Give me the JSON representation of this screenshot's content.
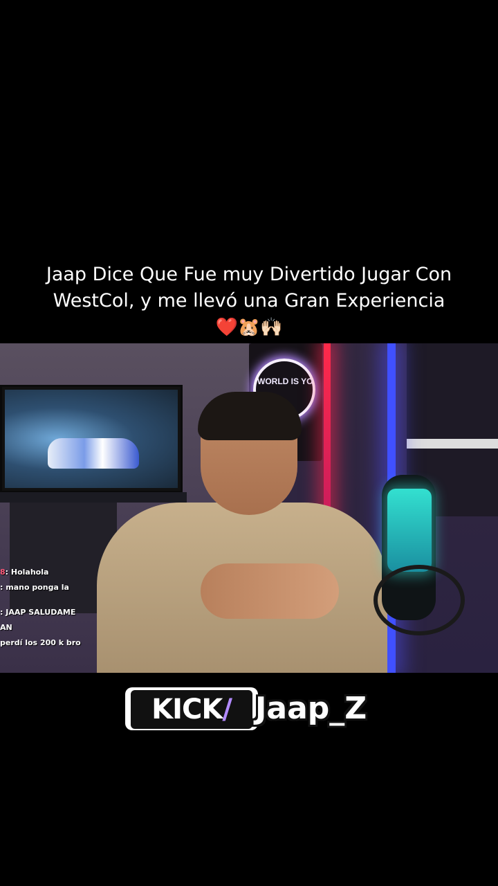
{
  "caption": {
    "line1": "Jaap Dice Que Fue muy Divertido Jugar Con",
    "line2": "WestCol, y me llevó una Gran Experiencia",
    "emoji": "❤️🐹🙌🏻"
  },
  "video": {
    "neon_sign_text": "WORLD IS YO",
    "chat": [
      {
        "user": "8",
        "text": ": Holahola"
      },
      {
        "user": "",
        "text": ": mano ponga la"
      },
      {
        "user": "",
        "text": ": JAAP SALUDAME"
      },
      {
        "user": "",
        "text": "AN"
      },
      {
        "user": "",
        "text": "perdí los 200 k bro"
      }
    ]
  },
  "brand": {
    "platform": "KICK",
    "slash": "/",
    "handle": "Jaap_Z"
  }
}
